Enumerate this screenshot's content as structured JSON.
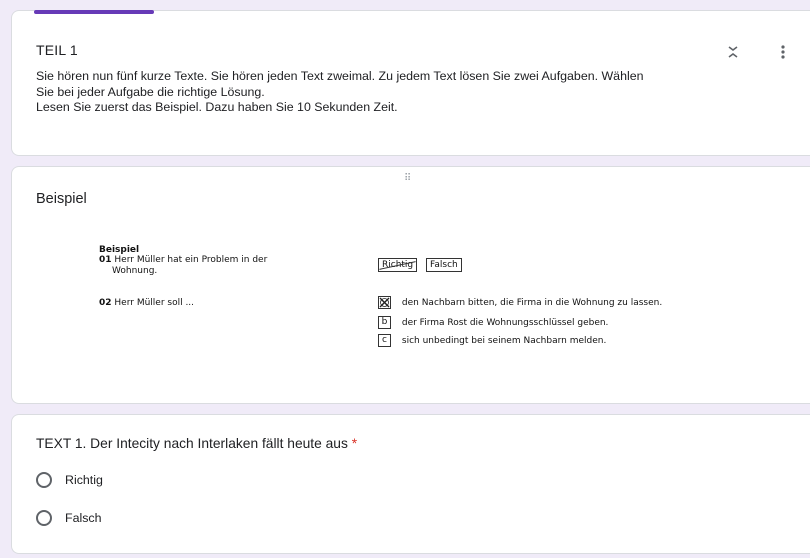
{
  "section": {
    "title": "TEIL 1",
    "description_line1": "Sie hören nun fünf kurze Texte. Sie hören jeden Text zweimal. Zu jedem Text lösen Sie zwei Aufgaben. Wählen",
    "description_line2": "Sie bei jeder Aufgabe die richtige Lösung.",
    "description_line3": "Lesen Sie zuerst das Beispiel. Dazu haben Sie 10 Sekunden Zeit.",
    "collapse_icon": "collapse-icon",
    "more_icon": "more-vert-icon"
  },
  "example": {
    "title": "Beispiel",
    "heading": "Beispiel",
    "q01_num": "01",
    "q01_text_line1": "Herr Müller hat ein Problem in der",
    "q01_text_line2": "Wohnung.",
    "q01_opt1": "Richtig",
    "q01_opt2": "Falsch",
    "q02_num": "02",
    "q02_text": "Herr Müller soll ...",
    "q02_a": "den Nachbarn bitten, die Firma in die Wohnung zu lassen.",
    "q02_b_letter": "b",
    "q02_b": "der Firma Rost die Wohnungsschlüssel geben.",
    "q02_c_letter": "c",
    "q02_c": "sich unbedingt bei seinem Nachbarn melden."
  },
  "question": {
    "text": "TEXT 1. Der Intecity nach Interlaken fällt heute aus",
    "required_mark": "*",
    "options": [
      "Richtig",
      "Falsch"
    ]
  },
  "colors": {
    "background": "#f0ebf8",
    "accent": "#673ab7",
    "required": "#d93025"
  }
}
